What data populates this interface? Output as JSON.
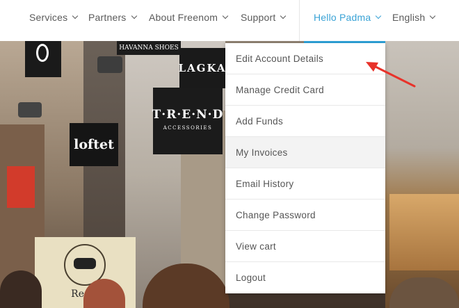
{
  "nav": {
    "items": [
      {
        "label": "Services"
      },
      {
        "label": "Partners"
      },
      {
        "label": "About Freenom"
      },
      {
        "label": "Support"
      }
    ],
    "user_menu": {
      "label": "Hello Padma"
    },
    "language": {
      "label": "English"
    }
  },
  "dropdown": {
    "items": [
      {
        "label": "Edit Account Details"
      },
      {
        "label": "Manage Credit Card"
      },
      {
        "label": "Add Funds"
      },
      {
        "label": "My Invoices",
        "highlighted": true
      },
      {
        "label": "Email History"
      },
      {
        "label": "Change Password"
      },
      {
        "label": "View cart"
      },
      {
        "label": "Logout"
      }
    ]
  },
  "background": {
    "signs": {
      "havanna": "HAVANNA SHOES",
      "lagka": "LAGKA",
      "trend": "T·R·E·N·D",
      "trend_sub": "ACCESSORIES",
      "loftet": "loftet",
      "rest": "Rest"
    }
  },
  "colors": {
    "accent": "#2ea1d8",
    "nav_text": "#5a5a5a",
    "annotation_arrow": "#e8322a"
  },
  "icons": {
    "chevron": "chevron-down-icon",
    "annotation": "red-arrow-icon"
  }
}
